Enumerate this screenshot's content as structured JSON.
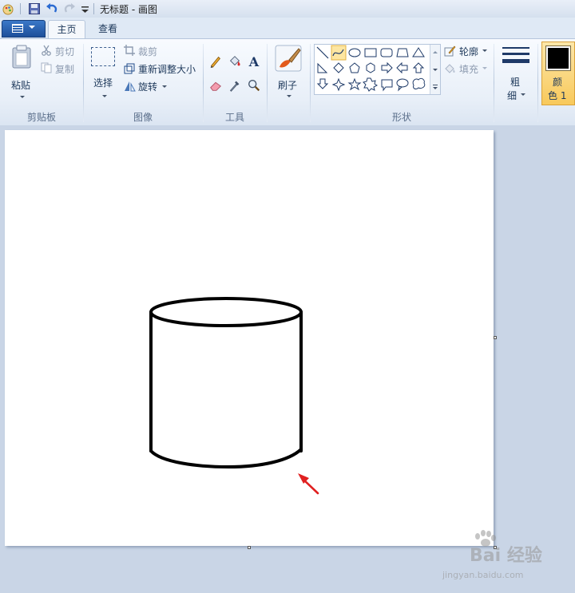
{
  "window": {
    "title": "无标题 - 画图"
  },
  "tabs": [
    {
      "label": "主页",
      "active": true
    },
    {
      "label": "查看",
      "active": false
    }
  ],
  "clipboard": {
    "paste_label": "粘贴",
    "cut_label": "剪切",
    "copy_label": "复制",
    "group_label": "剪贴板"
  },
  "image": {
    "select_label": "选择",
    "crop_label": "裁剪",
    "resize_label": "重新调整大小",
    "rotate_label": "旋转",
    "group_label": "图像"
  },
  "tools": {
    "group_label": "工具",
    "text_tool_glyph": "A"
  },
  "brushes": {
    "label": "刷子"
  },
  "shapes": {
    "outline_label": "轮廓",
    "fill_label": "填充",
    "group_label": "形状",
    "selected_shape": "curve"
  },
  "size": {
    "label_line1": "粗",
    "label_line2": "细"
  },
  "color1": {
    "label_line1": "颜",
    "label_line2": "色 1",
    "swatch": "#000000"
  },
  "colors": {
    "accent_arrow": "#e02020",
    "ribbon_blue": "#1e395b"
  },
  "watermark": {
    "brand": "Bai 经验",
    "url": "jingyan.baidu.com"
  }
}
